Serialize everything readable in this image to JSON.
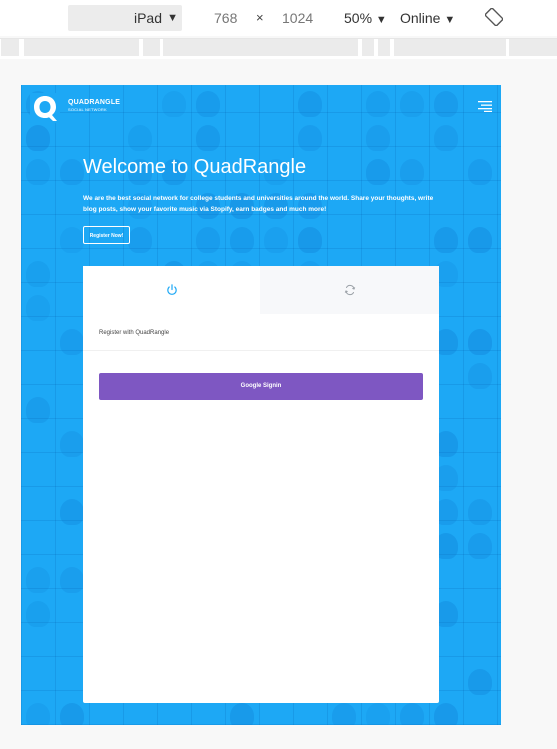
{
  "devtools": {
    "device": "iPad",
    "width": "768",
    "times": "×",
    "height": "1024",
    "zoom": "50%",
    "network": "Online",
    "caret": "▼"
  },
  "site": {
    "brand_name": "QUADRANGLE",
    "brand_tagline": "SOCIAL NETWORK",
    "hero_title": "Welcome to QuadRangle",
    "hero_text": "We are the best social network for college students and universities around the world. Share your thoughts, write blog posts, show your favorite music via Stopify, earn badges and much more!",
    "register_now": "Register Now!",
    "card": {
      "subtitle": "Register with QuadRangle",
      "google_signin": "Google Signin"
    }
  },
  "colors": {
    "hero_bg": "#1da8f5",
    "google_button": "#7e57c2",
    "tab_icon": "#1da8f5"
  }
}
